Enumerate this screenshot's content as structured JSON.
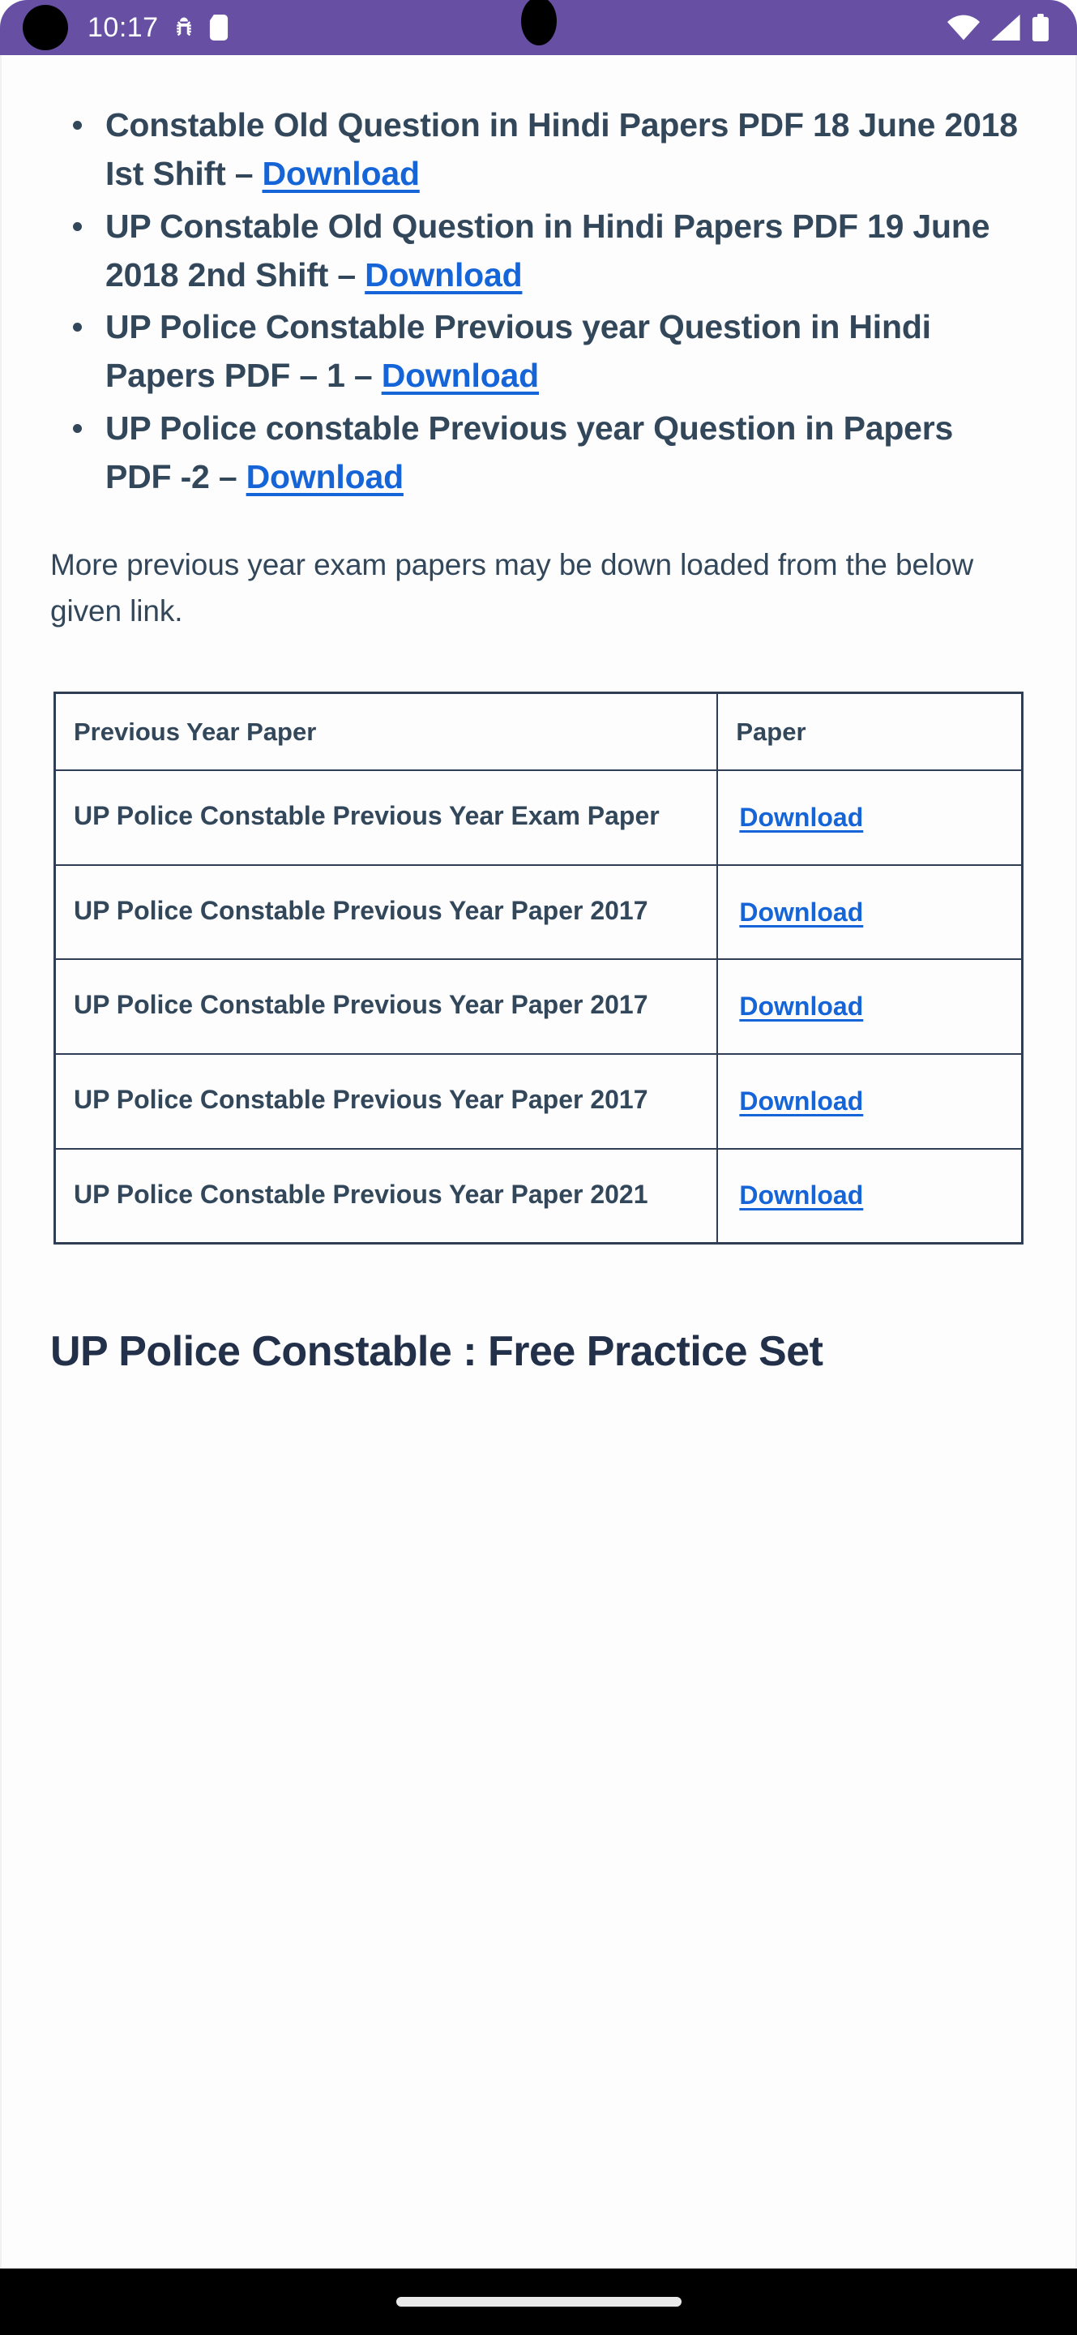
{
  "status_bar": {
    "time": "10:17",
    "icons_left": [
      "bug-icon",
      "sd-card-icon"
    ],
    "icons_right": [
      "wifi-icon",
      "cellular-signal-icon",
      "battery-icon"
    ],
    "background_color": "#6750a4"
  },
  "content": {
    "bullet_items": [
      {
        "text": "Constable Old Question in Hindi Papers PDF 18 June 2018 Ist Shift – ",
        "link_label": "Download"
      },
      {
        "text": "UP Constable Old Question in Hindi Papers PDF 19 June 2018 2nd Shift – ",
        "link_label": "Download"
      },
      {
        "text": "UP Police Constable Previous year Question in Hindi Papers PDF – 1 – ",
        "link_label": "Download"
      },
      {
        "text": "UP Police constable Previous year Question in Papers PDF -2 – ",
        "link_label": "Download"
      }
    ],
    "paragraph": "More previous year exam papers may be down loaded from the below given link.",
    "table": {
      "headers": [
        "Previous Year Paper",
        "Paper"
      ],
      "rows": [
        {
          "name": "UP Police Constable Previous Year Exam Paper",
          "action": "Download"
        },
        {
          "name": "UP Police Constable Previous Year Paper 2017",
          "action": "Download"
        },
        {
          "name": "UP Police Constable Previous Year Paper 2017",
          "action": "Download"
        },
        {
          "name": "UP Police Constable Previous Year Paper 2017",
          "action": "Download"
        },
        {
          "name": "UP Police Constable Previous Year Paper 2021",
          "action": "Download"
        }
      ]
    },
    "section_heading": "UP Police Constable : Free Practice Set"
  },
  "colors": {
    "link": "#1565d8",
    "body_text": "#33475b",
    "table_border": "#2f3e55",
    "status_bar": "#6750a4"
  },
  "nav_bar": {
    "gesture_pill": "home-gesture-pill"
  }
}
